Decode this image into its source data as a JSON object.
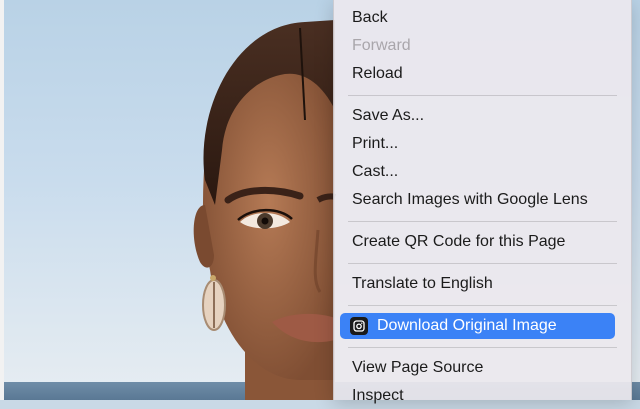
{
  "context_menu": {
    "items": [
      {
        "label": "Back",
        "enabled": true
      },
      {
        "label": "Forward",
        "enabled": false
      },
      {
        "label": "Reload",
        "enabled": true
      },
      {
        "label": "Save As...",
        "enabled": true
      },
      {
        "label": "Print...",
        "enabled": true
      },
      {
        "label": "Cast...",
        "enabled": true
      },
      {
        "label": "Search Images with Google Lens",
        "enabled": true
      },
      {
        "label": "Create QR Code for this Page",
        "enabled": true
      },
      {
        "label": "Translate to English",
        "enabled": true
      },
      {
        "label": "Download Original Image",
        "enabled": true,
        "highlighted": true,
        "icon": "camera-extension-icon"
      },
      {
        "label": "View Page Source",
        "enabled": true
      },
      {
        "label": "Inspect",
        "enabled": true
      }
    ]
  },
  "colors": {
    "highlight": "#3b82f6",
    "disabled_text": "#a9a6ab"
  }
}
